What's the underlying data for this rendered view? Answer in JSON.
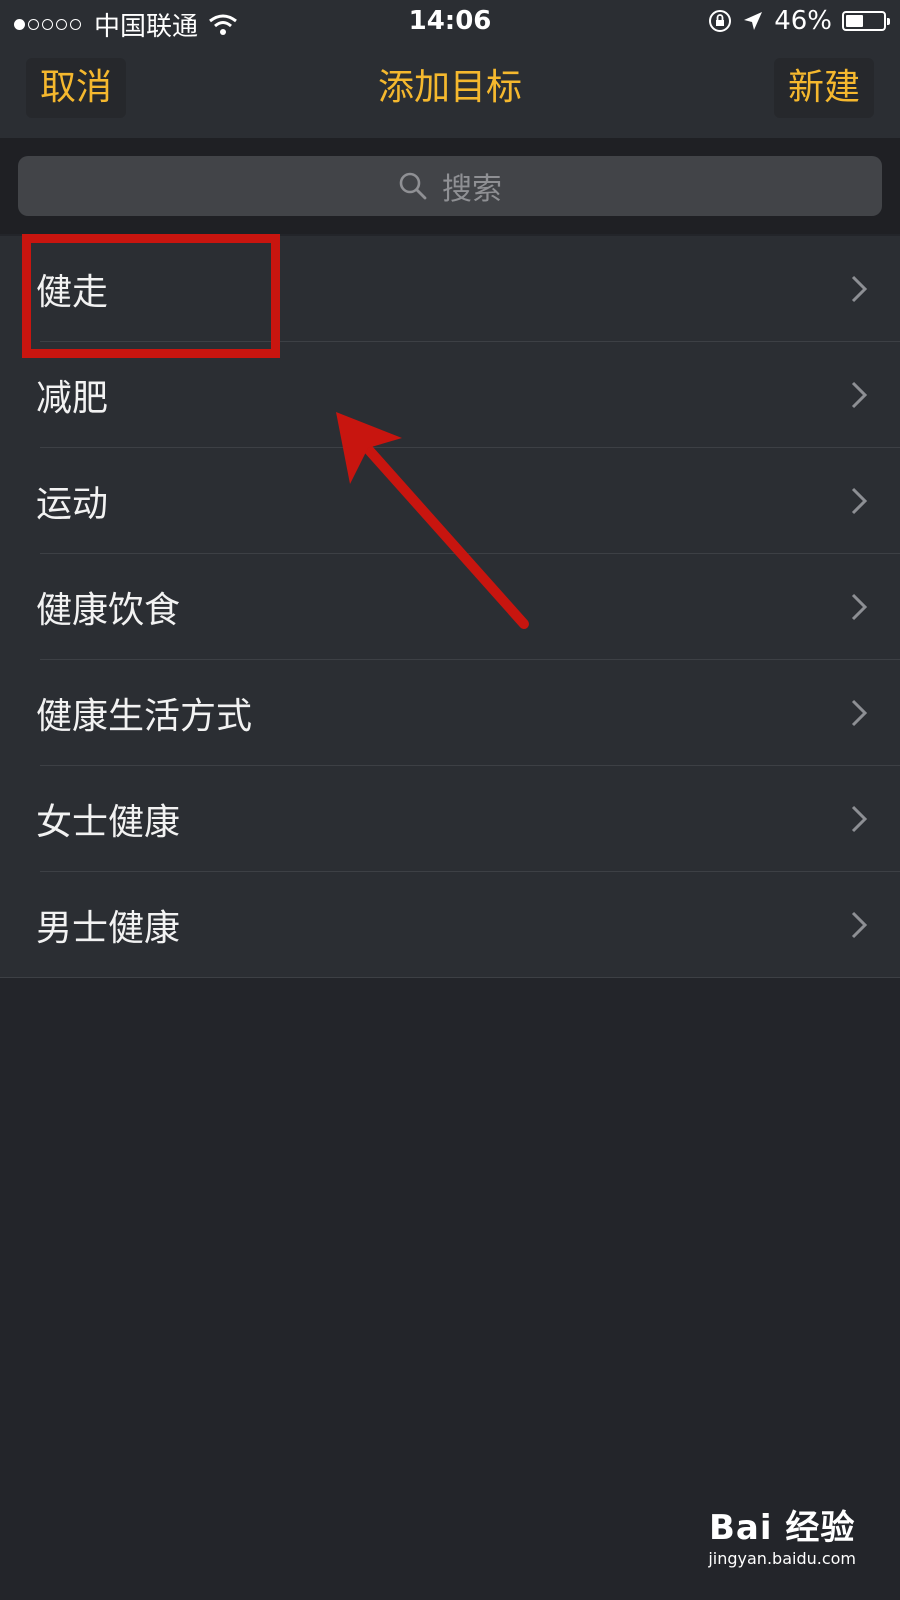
{
  "status_bar": {
    "carrier": "中国联通",
    "time": "14:06",
    "battery_text": "46%",
    "battery_level": 0.46
  },
  "nav": {
    "cancel_label": "取消",
    "title": "添加目标",
    "new_label": "新建"
  },
  "search": {
    "placeholder": "搜索"
  },
  "list": {
    "items": [
      {
        "label": "健走"
      },
      {
        "label": "减肥"
      },
      {
        "label": "运动"
      },
      {
        "label": "健康饮食"
      },
      {
        "label": "健康生活方式"
      },
      {
        "label": "女士健康"
      },
      {
        "label": "男士健康"
      }
    ]
  },
  "watermark": {
    "logo_text": "Bai 经验",
    "url": "jingyan.baidu.com"
  },
  "colors": {
    "accent": "#f5b82e",
    "annotation": "#c8150f"
  }
}
